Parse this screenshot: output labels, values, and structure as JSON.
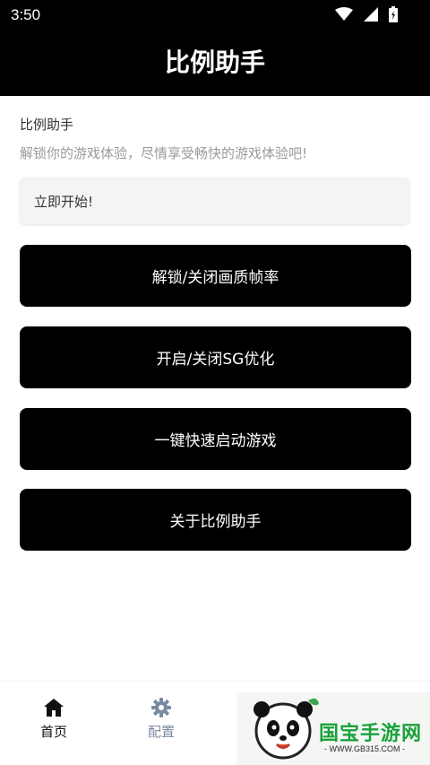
{
  "status_bar": {
    "time": "3:50",
    "icons": [
      "wifi-icon",
      "signal-icon",
      "battery-icon"
    ]
  },
  "header": {
    "title": "比例助手"
  },
  "content": {
    "title": "比例助手",
    "subtitle": "解锁你的游戏体验，尽情享受畅快的游戏体验吧!",
    "start_text": "立即开始!"
  },
  "buttons": [
    {
      "label": "解锁/关闭画质帧率"
    },
    {
      "label": "开启/关闭SG优化"
    },
    {
      "label": "一键快速启动游戏"
    },
    {
      "label": "关于比例助手"
    }
  ],
  "bottom_nav": {
    "items": [
      {
        "label": "首页",
        "icon": "home-icon",
        "active": true
      },
      {
        "label": "配置",
        "icon": "gear-icon",
        "active": false
      }
    ]
  },
  "watermark": {
    "brand": "国宝手游网",
    "url": "- WWW.GB315.COM -"
  },
  "colors": {
    "header_bg": "#000000",
    "button_bg": "#000000",
    "button_text": "#ffffff",
    "input_bg": "#f3f4f6",
    "nav_active": "#111111",
    "nav_inactive": "#7a8aa0",
    "watermark_green": "#1aa23a"
  }
}
